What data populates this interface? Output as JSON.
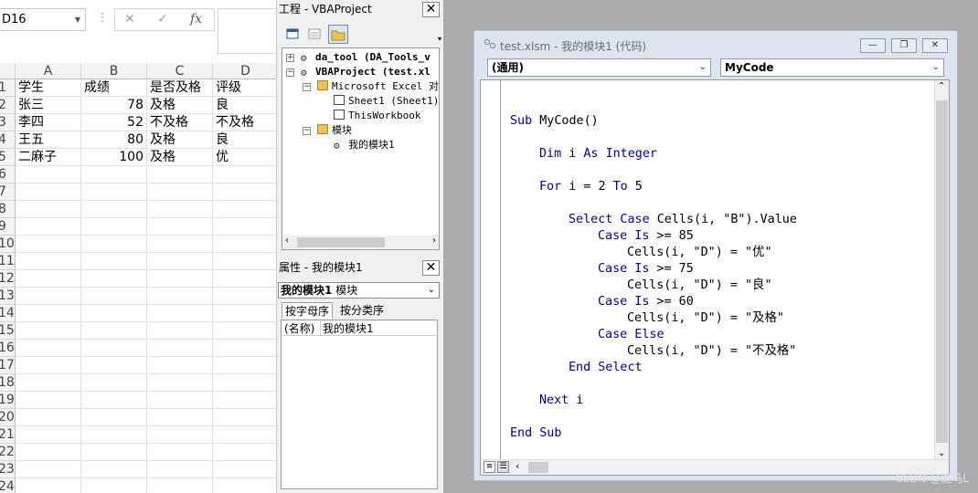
{
  "excel": {
    "name_box": "D16",
    "fx_label": "fx",
    "cancel_symbol": "✕",
    "enter_symbol": "✓",
    "columns": [
      "A",
      "B",
      "C",
      "D"
    ],
    "rows": [
      "1",
      "2",
      "3",
      "4",
      "5",
      "6",
      "7",
      "8",
      "9",
      "10",
      "11",
      "12",
      "13",
      "14",
      "15",
      "16",
      "17",
      "18",
      "19",
      "20",
      "21",
      "22",
      "23",
      "24"
    ],
    "cells": [
      [
        "学生",
        "成绩",
        "是否及格",
        "评级"
      ],
      [
        "张三",
        "78",
        "及格",
        "良"
      ],
      [
        "李四",
        "52",
        "不及格",
        "不及格"
      ],
      [
        "王五",
        "80",
        "及格",
        "良"
      ],
      [
        "二麻子",
        "100",
        "及格",
        "优"
      ]
    ]
  },
  "project_explorer": {
    "title": "工程 - VBAProject",
    "toolbar_icons": [
      "view-code-icon",
      "view-object-icon",
      "toggle-folders-icon"
    ],
    "tree": [
      {
        "label": "da_tool (DA_Tools_v",
        "bold": true,
        "expanded": false
      },
      {
        "label": "VBAProject (test.xl",
        "bold": true,
        "expanded": true
      },
      {
        "label": "Microsoft Excel 对象",
        "bold": false,
        "expanded": true
      },
      {
        "label": "Sheet1 (Sheet1)",
        "bold": false
      },
      {
        "label": "ThisWorkbook",
        "bold": false
      },
      {
        "label": "模块",
        "bold": false,
        "expanded": true
      },
      {
        "label": "我的模块1",
        "bold": false
      }
    ]
  },
  "properties": {
    "title": "属性 - 我的模块1",
    "object_name": "我的模块1",
    "object_type": "模块",
    "tabs": [
      "按字母序",
      "按分类序"
    ],
    "rows": [
      {
        "name": "(名称)",
        "value": "我的模块1"
      }
    ]
  },
  "code_window": {
    "title": "test.xlsm - 我的模块1 (代码)",
    "object_combo": "(通用)",
    "procedure_combo": "MyCode",
    "lines": [
      {
        "indent": 0,
        "parts": [
          {
            "k": true,
            "t": "Sub"
          },
          {
            "k": false,
            "t": " MyCode()"
          }
        ]
      },
      {
        "indent": 0,
        "parts": []
      },
      {
        "indent": 1,
        "parts": [
          {
            "k": true,
            "t": "Dim"
          },
          {
            "k": false,
            "t": " i "
          },
          {
            "k": true,
            "t": "As"
          },
          {
            "k": false,
            "t": " "
          },
          {
            "k": true,
            "t": "Integer"
          }
        ]
      },
      {
        "indent": 0,
        "parts": []
      },
      {
        "indent": 1,
        "parts": [
          {
            "k": true,
            "t": "For"
          },
          {
            "k": false,
            "t": " i = 2 "
          },
          {
            "k": true,
            "t": "To"
          },
          {
            "k": false,
            "t": " 5"
          }
        ]
      },
      {
        "indent": 0,
        "parts": []
      },
      {
        "indent": 2,
        "parts": [
          {
            "k": true,
            "t": "Select Case"
          },
          {
            "k": false,
            "t": " Cells(i, \"B\").Value"
          }
        ]
      },
      {
        "indent": 3,
        "parts": [
          {
            "k": true,
            "t": "Case Is"
          },
          {
            "k": false,
            "t": " >= 85"
          }
        ]
      },
      {
        "indent": 4,
        "parts": [
          {
            "k": false,
            "t": "Cells(i, \"D\") = \"优\""
          }
        ]
      },
      {
        "indent": 3,
        "parts": [
          {
            "k": true,
            "t": "Case Is"
          },
          {
            "k": false,
            "t": " >= 75"
          }
        ]
      },
      {
        "indent": 4,
        "parts": [
          {
            "k": false,
            "t": "Cells(i, \"D\") = \"良\""
          }
        ]
      },
      {
        "indent": 3,
        "parts": [
          {
            "k": true,
            "t": "Case Is"
          },
          {
            "k": false,
            "t": " >= 60"
          }
        ]
      },
      {
        "indent": 4,
        "parts": [
          {
            "k": false,
            "t": "Cells(i, \"D\") = \"及格\""
          }
        ]
      },
      {
        "indent": 3,
        "parts": [
          {
            "k": true,
            "t": "Case Else"
          }
        ]
      },
      {
        "indent": 4,
        "parts": [
          {
            "k": false,
            "t": "Cells(i, \"D\") = \"不及格\""
          }
        ]
      },
      {
        "indent": 2,
        "parts": [
          {
            "k": true,
            "t": "End Select"
          }
        ]
      },
      {
        "indent": 0,
        "parts": []
      },
      {
        "indent": 1,
        "parts": [
          {
            "k": true,
            "t": "Next"
          },
          {
            "k": false,
            "t": " i"
          }
        ]
      },
      {
        "indent": 0,
        "parts": []
      },
      {
        "indent": 0,
        "parts": [
          {
            "k": true,
            "t": "End Sub"
          }
        ]
      }
    ]
  },
  "colors": {
    "keyword": "#00008b",
    "mdi_background": "#ababab",
    "code_window_frame": "#dbe5f1"
  },
  "watermark": "CSDN @斑马L"
}
